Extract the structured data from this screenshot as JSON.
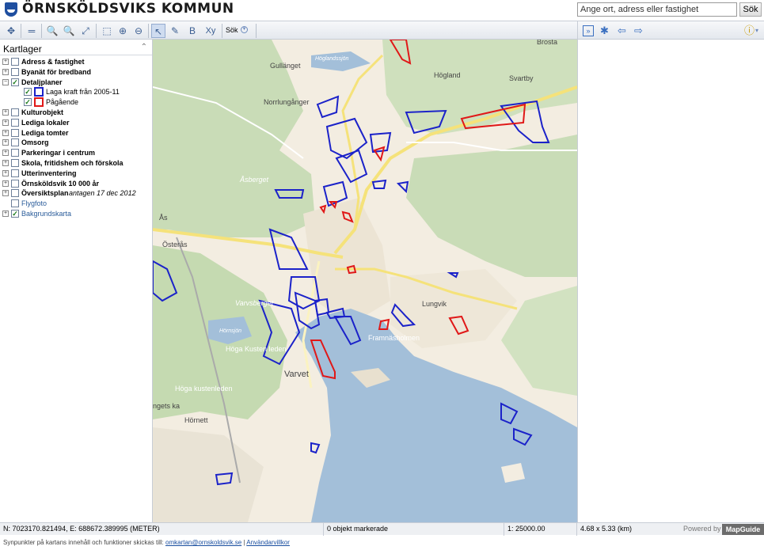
{
  "header": {
    "title": "ÖRNSKÖLDSVIKS KOMMUN",
    "search_placeholder": "Ange ort, adress eller fastighet",
    "search_button": "Sök"
  },
  "toolbar": {
    "search_label": "Sök",
    "icons": [
      "pan-icon",
      "measure-icon",
      "zoom-previous-icon",
      "zoom-next-icon",
      "zoom-extents-icon",
      "zoom-rectangle-icon",
      "zoom-in-icon",
      "zoom-out-icon",
      "select-icon",
      "select-radius-icon",
      "buffer-icon",
      "xy-coordinate-icon"
    ]
  },
  "layers_panel": {
    "title": "Kartlager",
    "items": [
      {
        "label": "Adress & fastighet",
        "checked": false,
        "expand": "+"
      },
      {
        "label": "Byanät för bredband",
        "checked": false,
        "expand": "+"
      },
      {
        "label": "Detaljplaner",
        "checked": true,
        "expand": "−"
      },
      {
        "label": "Laga kraft från 2005-11",
        "checked": true,
        "child": true,
        "swatch": "#1b22c9"
      },
      {
        "label": "Pågående",
        "checked": true,
        "child": true,
        "swatch": "#e01818"
      },
      {
        "label": "Kulturobjekt",
        "checked": false,
        "expand": "+"
      },
      {
        "label": "Lediga lokaler",
        "checked": false,
        "expand": "+"
      },
      {
        "label": "Lediga tomter",
        "checked": false,
        "expand": "+"
      },
      {
        "label": "Omsorg",
        "checked": false,
        "expand": "+"
      },
      {
        "label": "Parkeringar i centrum",
        "checked": false,
        "expand": "+"
      },
      {
        "label": "Skola, fritidshem och förskola",
        "checked": false,
        "expand": "+"
      },
      {
        "label": "Utterinventering",
        "checked": false,
        "expand": "+"
      },
      {
        "label": "Örnsköldsvik 10 000 år",
        "checked": false,
        "expand": "+"
      },
      {
        "label": "Översiktsplan",
        "suffix": " antagen 17 dec 2012",
        "checked": false,
        "expand": "+"
      },
      {
        "label": "Flygfoto",
        "checked": false,
        "plain": true
      },
      {
        "label": "Bakgrundskarta",
        "checked": true,
        "expand": "+",
        "plain": true
      }
    ]
  },
  "map": {
    "labels": [
      "Gullänget",
      "Höglandssjön",
      "Högland",
      "Svartby",
      "Norrlungånger",
      "Brosta",
      "Åsberget",
      "Ås",
      "Österås",
      "Varvsberget",
      "Hörnsjön",
      "Höga Kusten leden",
      "Lungvik",
      "Framnäsholmen",
      "Varvet",
      "Höga kustenleden",
      "ngets ka",
      "Hörnett"
    ]
  },
  "status": {
    "coordinates": "N: 7023170.821494, E: 688672.389995 (METER)",
    "selection": "0 objekt markerade",
    "scale": "1: 25000.00",
    "size": "4.68 x 5.33 (km)",
    "powered_by": "Powered by",
    "brand": "MapGuide"
  },
  "footer": {
    "text": "Synpunkter på kartans innehåll och funktioner skickas till:",
    "email": "omkartan@ornskoldsvik.se",
    "separator": "|",
    "terms": "Användarvillkor"
  },
  "colors": {
    "approved": "#1b22c9",
    "ongoing": "#e01818",
    "water": "#9fbcd8",
    "forest": "#c7dcb4",
    "road": "#f5e27a"
  }
}
